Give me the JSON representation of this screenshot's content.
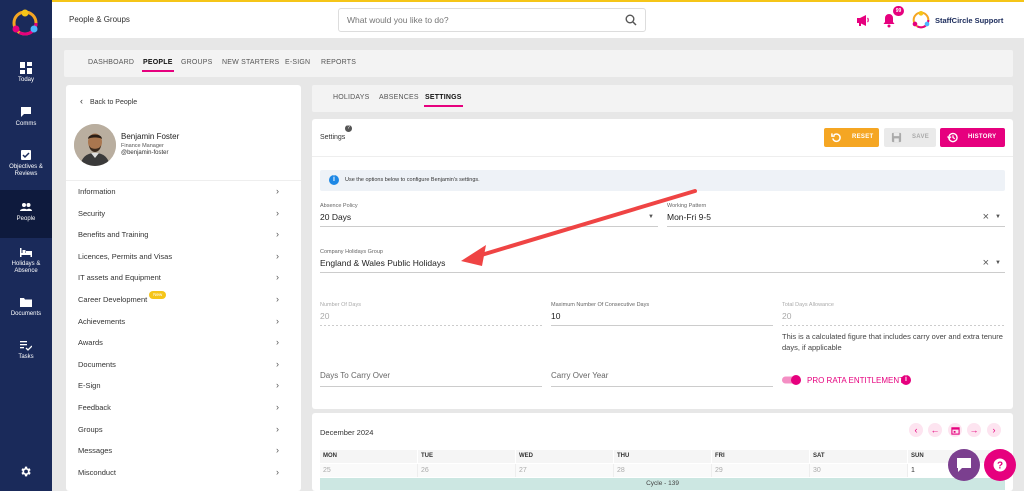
{
  "app": {
    "section_title": "People & Groups"
  },
  "search": {
    "placeholder": "What would you like to do?"
  },
  "header": {
    "notification_count": "99",
    "brand_name": "StaffCircle Support"
  },
  "sidebar": {
    "items": [
      {
        "label": "Today"
      },
      {
        "label": "Comms"
      },
      {
        "label": "Objectives & Reviews"
      },
      {
        "label": "People"
      },
      {
        "label": "Holidays & Absence"
      },
      {
        "label": "Documents"
      },
      {
        "label": "Tasks"
      }
    ]
  },
  "main_tabs": [
    {
      "label": "DASHBOARD"
    },
    {
      "label": "PEOPLE"
    },
    {
      "label": "GROUPS"
    },
    {
      "label": "NEW STARTERS"
    },
    {
      "label": "E-SIGN"
    },
    {
      "label": "REPORTS"
    }
  ],
  "profile": {
    "back_label": "Back to People",
    "name": "Benjamin Foster",
    "role": "Finance Manager",
    "handle": "@benjamin-foster"
  },
  "profile_menu": [
    {
      "label": "Information"
    },
    {
      "label": "Security"
    },
    {
      "label": "Benefits and Training"
    },
    {
      "label": "Licences, Permits and Visas"
    },
    {
      "label": "IT assets and Equipment"
    },
    {
      "label": "Career Development",
      "badge": "New"
    },
    {
      "label": "Achievements"
    },
    {
      "label": "Awards"
    },
    {
      "label": "Documents"
    },
    {
      "label": "E-Sign"
    },
    {
      "label": "Feedback"
    },
    {
      "label": "Groups"
    },
    {
      "label": "Messages"
    },
    {
      "label": "Misconduct"
    }
  ],
  "sub_tabs": [
    {
      "label": "HOLIDAYS"
    },
    {
      "label": "ABSENCES"
    },
    {
      "label": "SETTINGS"
    }
  ],
  "settings": {
    "title": "Settings",
    "help_glyph": "?",
    "reset_label": "RESET",
    "save_label": "SAVE",
    "history_label": "HISTORY",
    "info_glyph": "i",
    "info_text": "Use the options below to configure Benjamin's settings.",
    "absence_policy": {
      "label": "Absence Policy",
      "value": "20 Days"
    },
    "working_pattern": {
      "label": "Working Pattern",
      "value": "Mon-Fri 9-5"
    },
    "holidays_group": {
      "label": "Company Holidays Group",
      "value": "England & Wales Public Holidays"
    },
    "number_of_days": {
      "label": "Number Of Days",
      "value": "20"
    },
    "max_consecutive": {
      "label": "Maximum Number Of Consecutive Days",
      "value": "10"
    },
    "total_allowance": {
      "label": "Total Days Allowance",
      "value": "20"
    },
    "allowance_note": "This is a calculated figure that includes carry over and extra tenure days, if applicable",
    "carry_over_days": {
      "placeholder": "Days To Carry Over"
    },
    "carry_over_year": {
      "placeholder": "Carry Over Year"
    },
    "pro_rata": {
      "label": "PRO RATA ENTITLEMENT",
      "enabled": true,
      "info_glyph": "i"
    }
  },
  "calendar": {
    "month_label": "December 2024",
    "day_headers": [
      "MON",
      "TUE",
      "WED",
      "THU",
      "FRI",
      "SAT",
      "SUN"
    ],
    "dates": [
      "25",
      "26",
      "27",
      "28",
      "29",
      "30",
      "1"
    ],
    "cycle_label": "Cycle - 139"
  },
  "colors": {
    "accent": "#e6007e",
    "reset": "#f5a623",
    "sidebar": "#1a2a5a",
    "info": "#1e88e5",
    "annotation_arrow": "#ef4444"
  }
}
